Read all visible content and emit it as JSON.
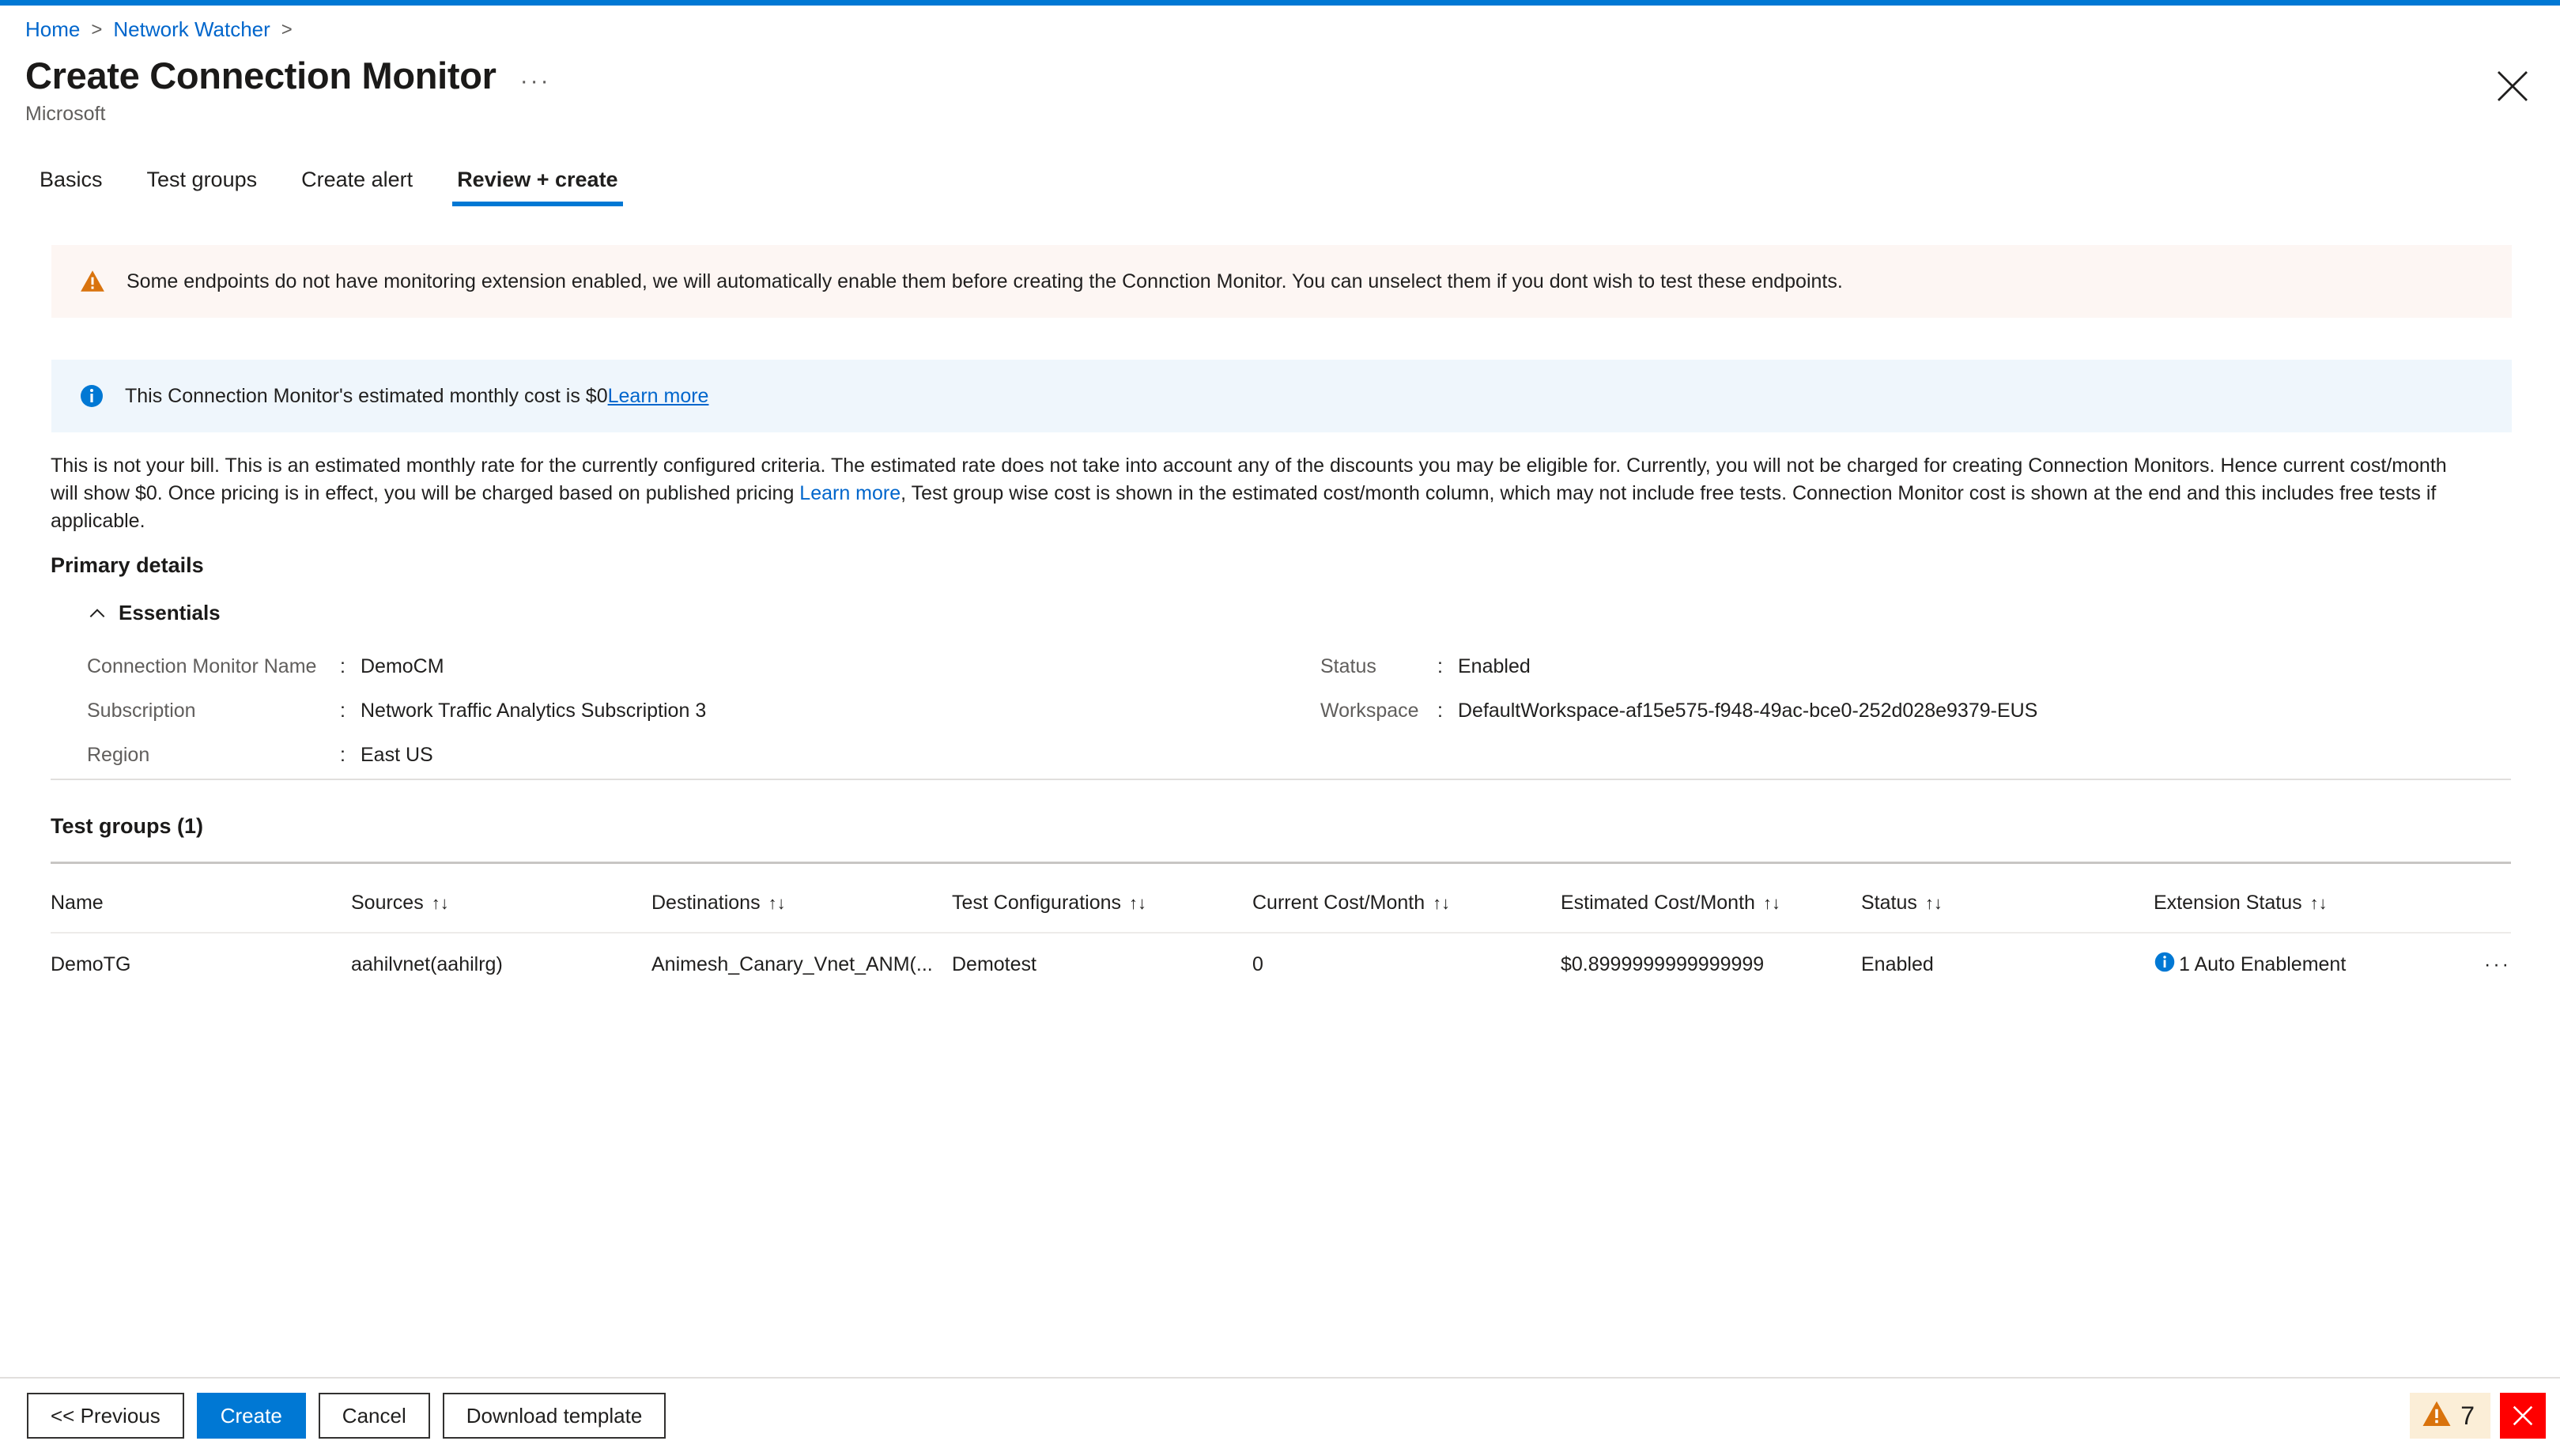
{
  "breadcrumb": {
    "items": [
      {
        "label": "Home"
      },
      {
        "label": "Network Watcher"
      }
    ],
    "separator": ">"
  },
  "header": {
    "title": "Create Connection Monitor",
    "ellipsis": "···",
    "subtitle": "Microsoft",
    "close_icon": "close-icon"
  },
  "tabs": [
    {
      "label": "Basics",
      "active": false
    },
    {
      "label": "Test groups",
      "active": false
    },
    {
      "label": "Create alert",
      "active": false
    },
    {
      "label": "Review + create",
      "active": true
    }
  ],
  "banners": {
    "warning": {
      "icon": "warning-triangle-icon",
      "text": "Some endpoints do not have monitoring extension enabled, we will automatically enable them before creating the Connction Monitor. You can unselect them if you dont wish to test these endpoints.",
      "background": "#fdf6f3",
      "icon_color": "#d9730d"
    },
    "info": {
      "icon": "info-circle-icon",
      "text": "This Connection Monitor's estimated monthly cost is $0",
      "link_label": "Learn more",
      "background": "#eff6fc",
      "icon_color": "#0078d4"
    }
  },
  "disclaimer": {
    "part1": "This is not your bill. This is an estimated monthly rate for the currently configured criteria. The estimated rate does not take into account any of the discounts you may be eligible for. Currently, you will not be charged for creating Connection Monitors. Hence current cost/month will show $0. Once pricing is in effect, you will be charged based on published pricing ",
    "link_label": "Learn more",
    "part2": ", Test group wise cost is shown in the estimated cost/month column, which may not include free tests. Connection Monitor cost is shown at the end and this includes free tests if applicable."
  },
  "primary_details": {
    "heading": "Primary details",
    "essentials": {
      "label": "Essentials",
      "expanded": true,
      "chevron_icon": "chevron-up-icon",
      "left_rows": [
        {
          "key": "Connection Monitor Name",
          "colon": ":",
          "value": "DemoCM"
        },
        {
          "key": "Subscription",
          "colon": ":",
          "value": "Network Traffic Analytics Subscription 3"
        },
        {
          "key": "Region",
          "colon": ":",
          "value": "East US"
        }
      ],
      "right_rows": [
        {
          "key": "Status",
          "colon": ":",
          "value": "Enabled"
        },
        {
          "key": "Workspace",
          "colon": ":",
          "value": "DefaultWorkspace-af15e575-f948-49ac-bce0-252d028e9379-EUS"
        },
        {
          "key": "",
          "colon": "",
          "value": ""
        }
      ]
    }
  },
  "test_groups": {
    "heading": "Test groups (1)",
    "sort_glyph": "↑↓",
    "columns": [
      {
        "label": "Name",
        "sortable": false
      },
      {
        "label": "Sources",
        "sortable": true
      },
      {
        "label": "Destinations",
        "sortable": true
      },
      {
        "label": "Test Configurations",
        "sortable": true
      },
      {
        "label": "Current Cost/Month",
        "sortable": true
      },
      {
        "label": "Estimated Cost/Month",
        "sortable": true
      },
      {
        "label": "Status",
        "sortable": true
      },
      {
        "label": "Extension Status",
        "sortable": true
      },
      {
        "label": "",
        "sortable": false
      }
    ],
    "rows": [
      {
        "name": "DemoTG",
        "sources": "aahilvnet(aahilrg)",
        "destinations": "Animesh_Canary_Vnet_ANM(...",
        "test_configurations": "Demotest",
        "current_cost": "0",
        "estimated_cost": "$0.8999999999999999",
        "status": "Enabled",
        "extension_status_icon": "info-circle-icon",
        "extension_status": "1 Auto Enablement",
        "row_menu": "···"
      }
    ]
  },
  "footer": {
    "buttons": [
      {
        "label": "<< Previous",
        "primary": false
      },
      {
        "label": "Create",
        "primary": true
      },
      {
        "label": "Cancel",
        "primary": false
      },
      {
        "label": "Download template",
        "primary": false
      }
    ],
    "status": {
      "warning_icon": "warning-triangle-icon",
      "warning_count": "7",
      "close_icon": "close-icon",
      "warning_background": "#fbeed7",
      "close_background": "#ff0000"
    }
  },
  "colors": {
    "accent": "#0078d4",
    "link": "#0066cc",
    "warning": "#d9730d",
    "danger": "#ff0000"
  }
}
